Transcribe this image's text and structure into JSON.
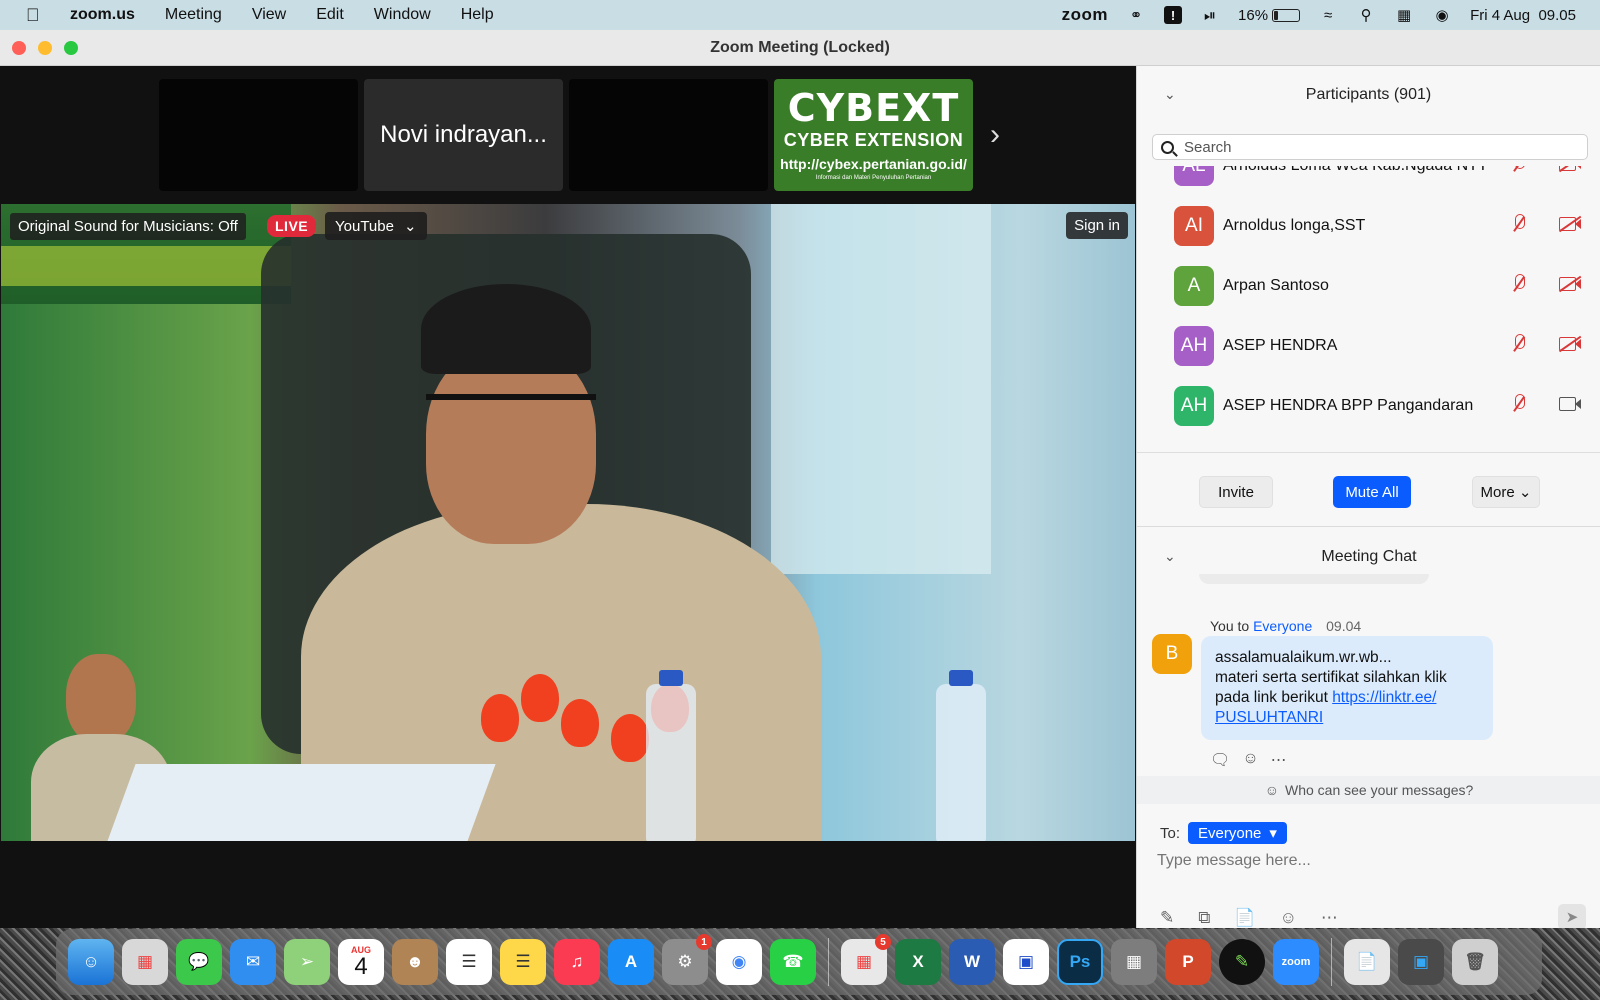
{
  "menubar": {
    "app": "zoom.us",
    "items": [
      "Meeting",
      "View",
      "Edit",
      "Window",
      "Help"
    ],
    "zoom_logo": "zoom",
    "battery": "16%",
    "battery_level": 0.16,
    "date": "Fri 4 Aug",
    "time": "09.05",
    "icons": [
      "apple-icon",
      "zoom-logo",
      "creative-cloud-icon",
      "alert-icon",
      "play-icon",
      "battery-icon",
      "wifi-icon",
      "search-icon",
      "control-center-icon",
      "siri-icon"
    ]
  },
  "window": {
    "title": "Zoom Meeting (Locked)"
  },
  "gallery": {
    "tiles": [
      "",
      "Novi indrayan...",
      "",
      ""
    ],
    "cybex": {
      "t1": "CYBEXT",
      "t2": "CYBER EXTENSION",
      "t3": "http://cybex.pertanian.go.id/",
      "t4": "Informasi dan Materi Penyuluhan Pertanian"
    }
  },
  "video": {
    "sound": "Original Sound for Musicians: Off",
    "live": "LIVE",
    "stream": "YouTube",
    "signin": "Sign in"
  },
  "participants": {
    "title": "Participants (901)",
    "search_placeholder": "Search",
    "rows": [
      {
        "initials": "AL",
        "name": "Arnoldus Loma Wea Kab.Ngada NTT",
        "color": "#a55fc7",
        "cam_on": false
      },
      {
        "initials": "AI",
        "name": "Arnoldus longa,SST",
        "color": "#d9533c",
        "cam_on": false
      },
      {
        "initials": "A",
        "name": "Arpan Santoso",
        "color": "#5ea33b",
        "cam_on": false
      },
      {
        "initials": "AH",
        "name": "ASEP HENDRA",
        "color": "#a55fc7",
        "cam_on": false
      },
      {
        "initials": "AH",
        "name": "ASEP HENDRA BPP Pangandaran",
        "color": "#2fb56a",
        "cam_on": true
      }
    ],
    "invite": "Invite",
    "mute_all": "Mute All",
    "more": "More"
  },
  "chat": {
    "title": "Meeting Chat",
    "sender": "You to",
    "recipient": "Everyone",
    "time": "09.04",
    "avatar": "B",
    "line1": "assalamualaikum.wr.wb...",
    "line2": "materi serta sertifikat silahkan klik",
    "line3": "pada link berikut",
    "link": "https://linktr.ee/ PUSLUHTANRI",
    "who": "Who can see your messages?",
    "to_label": "To:",
    "to_value": "Everyone",
    "placeholder": "Type message here..."
  },
  "dock": {
    "badges": {
      "settings": "1",
      "office": "5"
    },
    "calendar_month": "AUG",
    "calendar_day": "4"
  }
}
